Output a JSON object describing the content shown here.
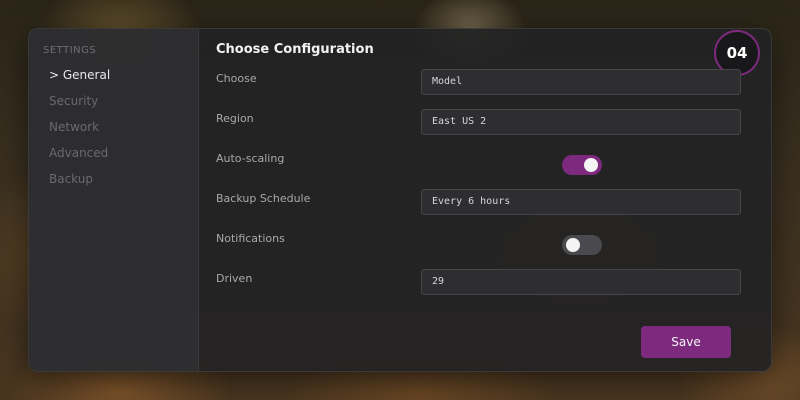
{
  "sidebar": {
    "heading": "SETTINGS",
    "items": [
      {
        "label": "> General",
        "active": true
      },
      {
        "label": "Security",
        "active": false
      },
      {
        "label": "Network",
        "active": false
      },
      {
        "label": "Advanced",
        "active": false
      },
      {
        "label": "Backup",
        "active": false
      }
    ]
  },
  "main": {
    "title": "Choose Configuration",
    "step": "04",
    "fields": {
      "choose": {
        "label": "Choose",
        "value": "Model"
      },
      "region": {
        "label": "Region",
        "value": "East US 2"
      },
      "autoscaling": {
        "label": "Auto-scaling",
        "enabled": true
      },
      "backup_schedule": {
        "label": "Backup Schedule",
        "value": "Every 6 hours"
      },
      "notifications": {
        "label": "Notifications",
        "enabled": false
      },
      "driven": {
        "label": "Driven",
        "value": "29"
      }
    },
    "save_label": "Save"
  },
  "colors": {
    "accent": "#7d2a7e",
    "panel": "#222224",
    "sidebar": "#2e2e30",
    "toggle_off": "#4a4a4e"
  }
}
